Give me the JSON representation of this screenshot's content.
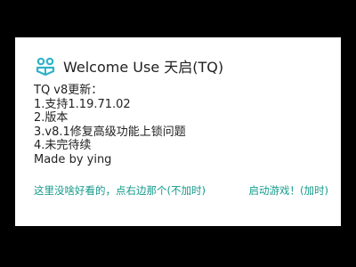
{
  "dialog": {
    "icon": "app-logo-icon",
    "title": "Welcome Use 天启(TQ)",
    "message_lines": [
      "TQ v8更新：",
      "1.支持1.19.71.02",
      "2.版本",
      "3.v8.1修复高级功能上锁问题",
      "4.未完待续",
      "Made by ying"
    ],
    "neutral_button": "这里没啥好看的，点右边那个(不加时)",
    "positive_button": "启动游戏！(加时)"
  },
  "colors": {
    "accent": "#139a8a",
    "background": "#000000",
    "dialog_background": "#ffffff",
    "text": "#222222"
  }
}
